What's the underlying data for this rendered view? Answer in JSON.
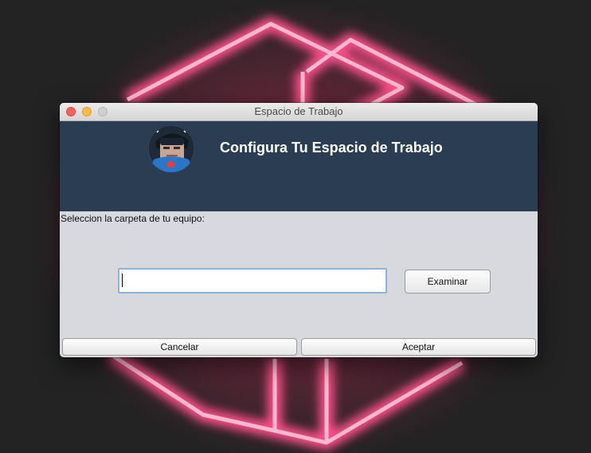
{
  "window": {
    "title": "Espacio de Trabajo"
  },
  "banner": {
    "title": "Configura Tu Espacio de Trabajo",
    "avatar_icon": "robot-mascot-icon"
  },
  "form": {
    "prompt_label": "Seleccion la carpeta de tu equipo:",
    "path_value": "",
    "browse_label": "Examinar"
  },
  "footer": {
    "cancel_label": "Cancelar",
    "accept_label": "Aceptar"
  },
  "colors": {
    "banner_bg": "#2b3d52",
    "window_bg": "#d7d9df",
    "neon_accent": "#ff3d7f",
    "desktop_bg": "#232323"
  }
}
